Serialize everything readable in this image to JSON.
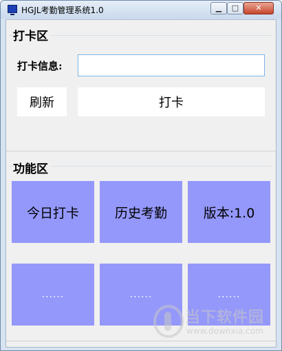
{
  "window": {
    "title": "HGJL考勤管理系统1.0",
    "controls": {
      "minimize": "▁",
      "maximize": "□",
      "close": "✕"
    }
  },
  "punch_group": {
    "title": "打卡区",
    "info_label": "打卡信息:",
    "info_value": "",
    "info_placeholder": "",
    "refresh_label": "刷新",
    "punch_label": "打卡"
  },
  "function_group": {
    "title": "功能区",
    "tiles": [
      {
        "label": "今日打卡"
      },
      {
        "label": "历史考勤"
      },
      {
        "label": "版本:1.0"
      },
      {
        "label": "......"
      },
      {
        "label": "......"
      },
      {
        "label": "......"
      }
    ]
  },
  "watermark": {
    "text": "当下软件园",
    "url": "www.downxia.com"
  },
  "colors": {
    "tile": "#9498fb",
    "client_bg": "#f0f0f0",
    "input_border": "#7eb4ea"
  }
}
